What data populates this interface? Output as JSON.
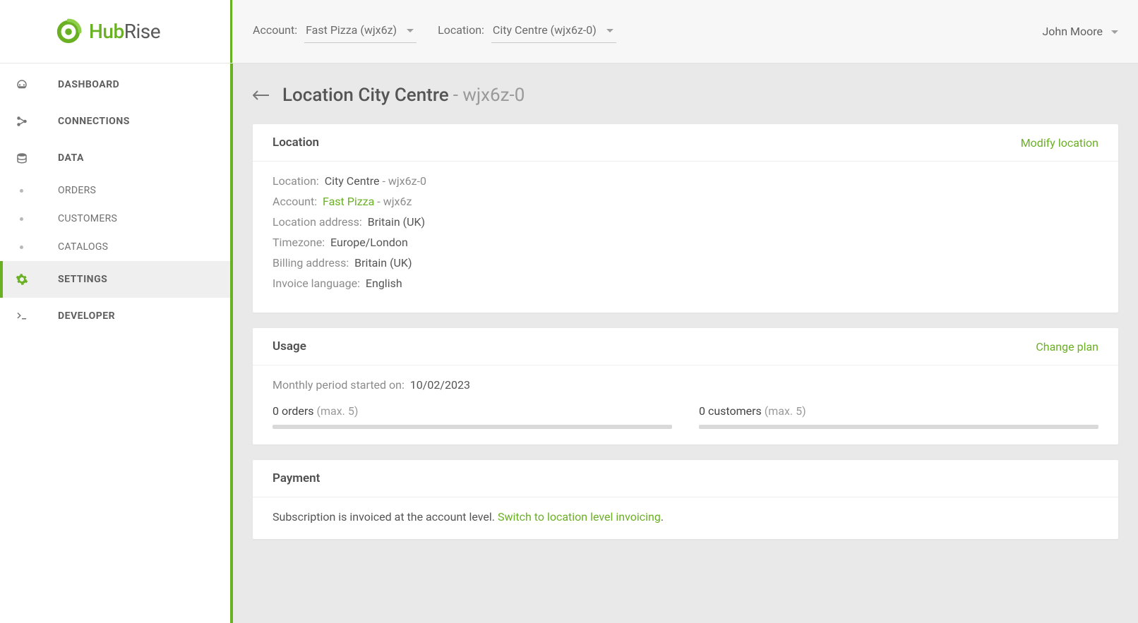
{
  "brand": {
    "name1": "Hub",
    "name2": "Rise"
  },
  "topbar": {
    "account_label": "Account:",
    "account_value": "Fast Pizza (wjx6z)",
    "location_label": "Location:",
    "location_value": "City Centre (wjx6z-0)",
    "user_name": "John Moore"
  },
  "sidebar": {
    "items": [
      {
        "label": "DASHBOARD"
      },
      {
        "label": "CONNECTIONS"
      },
      {
        "label": "DATA"
      },
      {
        "label": "SETTINGS"
      },
      {
        "label": "DEVELOPER"
      }
    ],
    "data_sub": [
      {
        "label": "ORDERS"
      },
      {
        "label": "CUSTOMERS"
      },
      {
        "label": "CATALOGS"
      }
    ]
  },
  "page": {
    "prefix": "Location ",
    "name": "City Centre",
    "id_spacer": " - ",
    "id": "wjx6z-0"
  },
  "location_card": {
    "title": "Location",
    "action": "Modify location",
    "rows": {
      "location_k": "Location:",
      "location_v": "City Centre",
      "location_id": " - wjx6z-0",
      "account_k": "Account:",
      "account_link": "Fast Pizza",
      "account_id": " - wjx6z",
      "address_k": "Location address:",
      "address_v": "Britain (UK)",
      "tz_k": "Timezone:",
      "tz_v": "Europe/London",
      "billing_k": "Billing address:",
      "billing_v": "Britain (UK)",
      "lang_k": "Invoice language:",
      "lang_v": "English"
    }
  },
  "usage_card": {
    "title": "Usage",
    "action": "Change plan",
    "period_k": "Monthly period started on:",
    "period_v": "10/02/2023",
    "orders_count": "0 orders",
    "orders_max": " (max. 5)",
    "customers_count": "0 customers",
    "customers_max": " (max. 5)"
  },
  "payment_card": {
    "title": "Payment",
    "text_before": "Subscription is invoiced at the account level. ",
    "link": "Switch to location level invoicing",
    "text_after": "."
  }
}
